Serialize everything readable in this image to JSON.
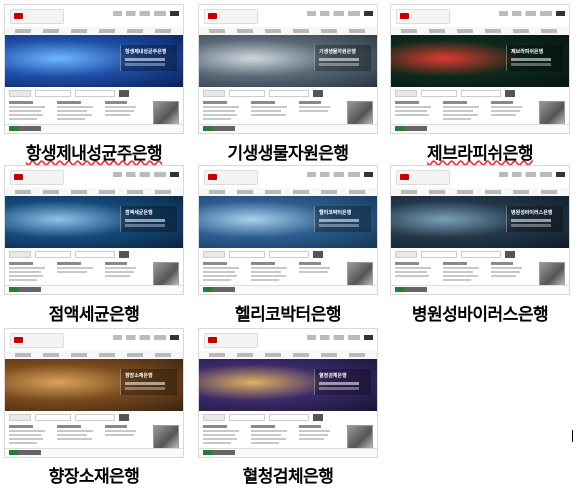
{
  "banks": [
    {
      "label": "항생제내성균주은행",
      "hero_title": "항생제내성균주은행",
      "colors": {
        "a": "#1e4fa8",
        "b": "#6fb6ff",
        "c": "#0b1f55"
      },
      "spellcheck_underline": true
    },
    {
      "label": "기생생물자원은행",
      "hero_title": "기생생물자원은행",
      "colors": {
        "a": "#5a6a78",
        "b": "#cfd8df",
        "c": "#2a3440"
      },
      "spellcheck_underline": false
    },
    {
      "label": "제브라피쉬은행",
      "hero_title": "제브라피쉬은행",
      "colors": {
        "a": "#0c2a1c",
        "b": "#e03b2f",
        "c": "#08140f"
      },
      "spellcheck_underline": true
    },
    {
      "label": "점액세균은행",
      "hero_title": "점액세균은행",
      "colors": {
        "a": "#164a7a",
        "b": "#8fc3ea",
        "c": "#0a2440"
      },
      "spellcheck_underline": false
    },
    {
      "label": "헬리코박터은행",
      "hero_title": "헬리코박터은행",
      "colors": {
        "a": "#2d5e8f",
        "b": "#a9d2ee",
        "c": "#163657"
      },
      "spellcheck_underline": false
    },
    {
      "label": "병원성바이러스은행",
      "hero_title": "병원성바이러스은행",
      "colors": {
        "a": "#24384a",
        "b": "#7aa0b8",
        "c": "#0f1c28"
      },
      "spellcheck_underline": false
    },
    {
      "label": "향장소재은행",
      "hero_title": "향장소재은행",
      "colors": {
        "a": "#7a4a1e",
        "b": "#d9a35a",
        "c": "#3a2410"
      },
      "spellcheck_underline": false
    },
    {
      "label": "혈청검체은행",
      "hero_title": "혈청검체은행",
      "colors": {
        "a": "#3b2a6a",
        "b": "#e0b060",
        "c": "#1a1436"
      },
      "spellcheck_underline": false
    }
  ]
}
